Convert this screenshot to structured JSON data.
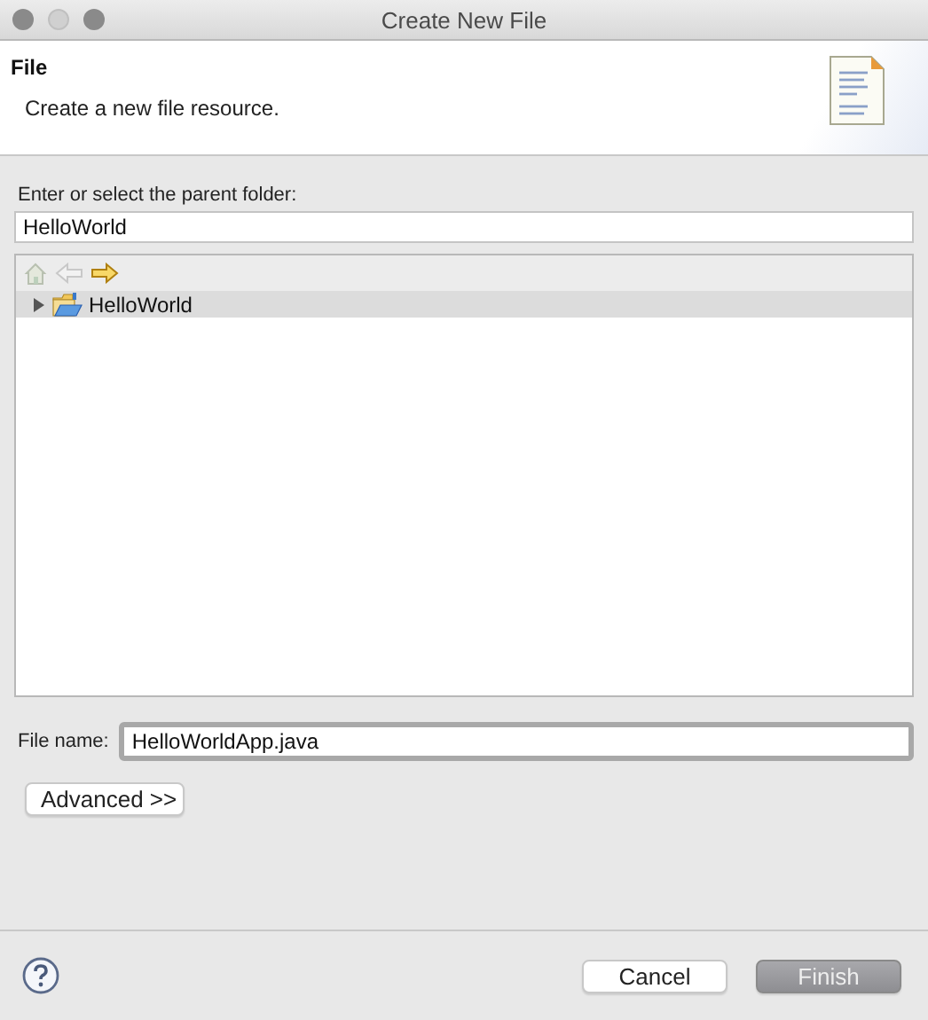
{
  "window": {
    "title": "Create New File"
  },
  "header": {
    "title": "File",
    "description": "Create a new file resource."
  },
  "parent_folder": {
    "label": "Enter or select the parent folder:",
    "value": "HelloWorld"
  },
  "navigation": [
    {
      "kind": "home",
      "disabled": true
    },
    {
      "kind": "back",
      "disabled": true
    },
    {
      "kind": "forward",
      "disabled": false
    }
  ],
  "tree": [
    {
      "label": "HelloWorld",
      "expanded": false,
      "selected": true
    }
  ],
  "file_name": {
    "label": "File name:",
    "value": "HelloWorldApp.java"
  },
  "advanced_button": "Advanced >>",
  "buttons": [
    {
      "label": "Cancel",
      "default": false
    },
    {
      "label": "Finish",
      "default": true
    }
  ]
}
